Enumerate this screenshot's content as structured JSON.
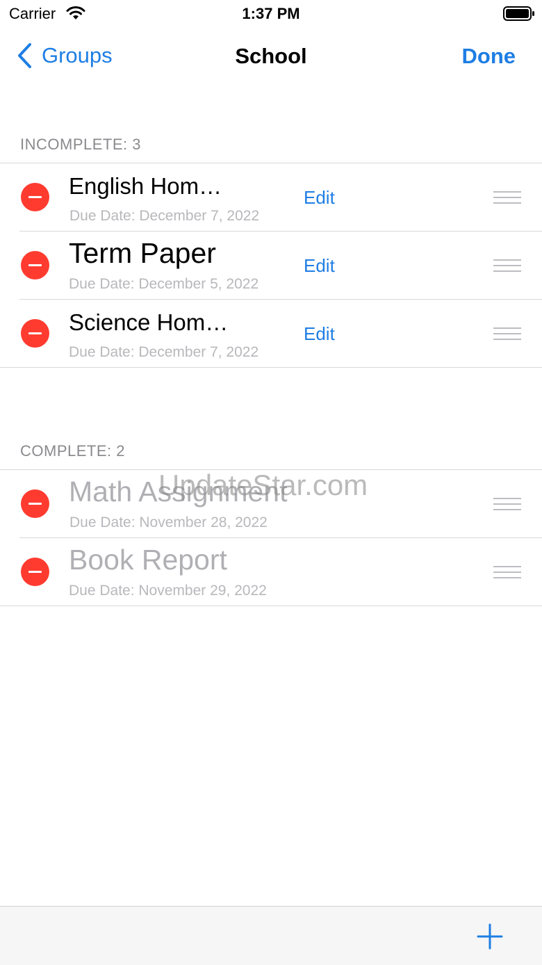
{
  "status_bar": {
    "carrier": "Carrier",
    "time": "1:37 PM"
  },
  "nav": {
    "back_label": "Groups",
    "title": "School",
    "done_label": "Done"
  },
  "sections": [
    {
      "header": "INCOMPLETE: 3",
      "items": [
        {
          "title": "English Hom…",
          "due": "Due Date: December 7, 2022",
          "edit": "Edit"
        },
        {
          "title": "Term Paper",
          "due": "Due Date: December 5, 2022",
          "edit": "Edit"
        },
        {
          "title": "Science Hom…",
          "due": "Due Date: December 7, 2022",
          "edit": "Edit"
        }
      ]
    },
    {
      "header": "COMPLETE: 2",
      "items": [
        {
          "title": "Math Assignment",
          "due": "Due Date: November 28, 2022"
        },
        {
          "title": "Book Report",
          "due": "Due Date: November 29, 2022"
        }
      ]
    }
  ],
  "watermark": "UpdateStar.com",
  "colors": {
    "accent": "#1e7ee4",
    "delete": "#ff3b30",
    "secondary_text": "#8a8a8e",
    "completed_text": "#b0b0b4"
  }
}
